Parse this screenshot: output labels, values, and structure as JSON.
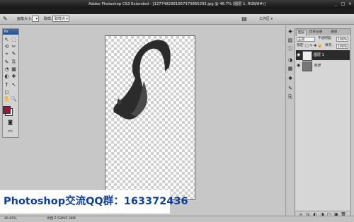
{
  "window": {
    "title": "Adobe Photoshop CS3 Extended - [1277482981067370865292.jpg @ 46.7% (图层 1, RGB/8#)]",
    "app_badge": "Ps",
    "minimize": "_",
    "maximize": "□",
    "close": "×"
  },
  "options_bar": {
    "tool_icon": "brush-icon",
    "brush_size_label": "画笔大小:",
    "sample_label": "取样:",
    "sample_value": "取样点",
    "workspace_label": "工作区 ▾"
  },
  "toolbox": {
    "header": "Ps",
    "tools": [
      "↖",
      "⬚",
      "⟲",
      "✂",
      "⌖",
      "✎",
      "✎",
      "⎘",
      "◔",
      "▦",
      "◐",
      "✚",
      "T",
      "↖",
      "◻",
      "✋",
      "🔍"
    ],
    "foreground_color": "#a3123a",
    "background_color": "#ffffff"
  },
  "layers_panel": {
    "tabs": [
      "图层",
      "历史记录",
      "通道"
    ],
    "blend_mode": "正常",
    "opacity_label": "不透明度:",
    "opacity_value": "100%",
    "lock_label": "锁定:",
    "fill_label": "填充:",
    "fill_value": "100%",
    "layers": [
      {
        "name": "图层 1",
        "selected": true
      },
      {
        "name": "背景",
        "selected": false
      }
    ],
    "bottom_icons": [
      "∞",
      "fx",
      "◐",
      "◑",
      "□",
      "▣",
      "🗑"
    ]
  },
  "status": {
    "zoom": "46.65%",
    "doc_info": "文档:2.53M/5.38M"
  },
  "watermark": {
    "text": "Photoshop交流QQ群：163372436"
  },
  "colors": {
    "accent": "#0f3ea3",
    "selection": "#2b2b2b"
  }
}
